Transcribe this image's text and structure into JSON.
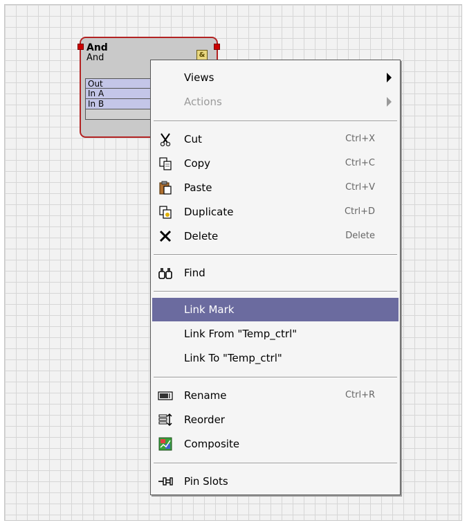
{
  "node": {
    "title": "And",
    "type": "And",
    "icon": "and-gate-icon",
    "slots": [
      "Out",
      "In A",
      "In B"
    ]
  },
  "menu": {
    "views": "Views",
    "actions": "Actions",
    "cut": {
      "label": "Cut",
      "shortcut": "Ctrl+X",
      "icon": "scissors-icon"
    },
    "copy": {
      "label": "Copy",
      "shortcut": "Ctrl+C",
      "icon": "copy-icon"
    },
    "paste": {
      "label": "Paste",
      "shortcut": "Ctrl+V",
      "icon": "paste-icon"
    },
    "duplicate": {
      "label": "Duplicate",
      "shortcut": "Ctrl+D",
      "icon": "duplicate-icon"
    },
    "delete": {
      "label": "Delete",
      "shortcut": "Delete",
      "icon": "delete-x-icon"
    },
    "find": {
      "label": "Find",
      "icon": "binoculars-icon"
    },
    "link_mark": "Link Mark",
    "link_from": "Link From \"Temp_ctrl\"",
    "link_to": "Link To \"Temp_ctrl\"",
    "rename": {
      "label": "Rename",
      "shortcut": "Ctrl+R",
      "icon": "rename-icon"
    },
    "reorder": {
      "label": "Reorder",
      "icon": "reorder-icon"
    },
    "composite": {
      "label": "Composite",
      "icon": "composite-icon"
    },
    "pin_slots": {
      "label": "Pin Slots",
      "icon": "pin-icon"
    }
  },
  "colors": {
    "highlight": "#6b6b9f",
    "node_border": "#b22222",
    "slot_fill": "#c4c6e8"
  }
}
